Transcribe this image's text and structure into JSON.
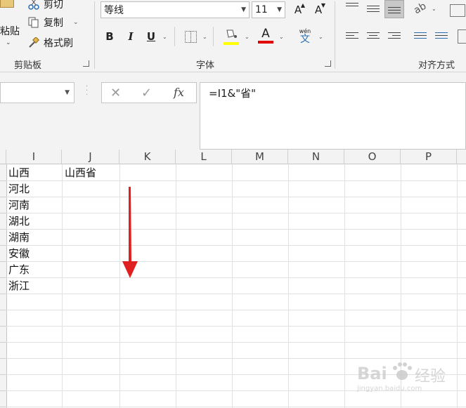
{
  "clipboard": {
    "paste_label": "粘贴",
    "cut_label": "剪切",
    "copy_label": "复制",
    "format_painter_label": "格式刷",
    "group_label": "剪贴板"
  },
  "font": {
    "font_name": "等线",
    "font_size": "11",
    "bold": "B",
    "italic": "I",
    "underline": "U",
    "grow": "A",
    "shrink": "A",
    "font_color_glyph": "A",
    "phonetic_glyph": "文",
    "phonetic_top": "wén",
    "group_label": "字体",
    "fill_color": "#ffff00",
    "font_color": "#e00000"
  },
  "alignment": {
    "group_label": "对齐方式"
  },
  "formula_bar": {
    "name_box": "",
    "cancel": "✕",
    "enter": "✓",
    "fx": "fx",
    "formula": "=I1&\"省\""
  },
  "grid": {
    "columns": [
      "I",
      "J",
      "K",
      "L",
      "M",
      "N",
      "O",
      "P"
    ],
    "column_i": [
      "山西",
      "河北",
      "河南",
      "湖北",
      "湖南",
      "安徽",
      "广东",
      "浙江"
    ],
    "column_j": [
      "山西省"
    ]
  },
  "annotation": {
    "arrow_color": "#e02020"
  },
  "watermark": {
    "brand": "Bai",
    "brand_cn": "经验",
    "url": "jingyan.baidu.com"
  }
}
